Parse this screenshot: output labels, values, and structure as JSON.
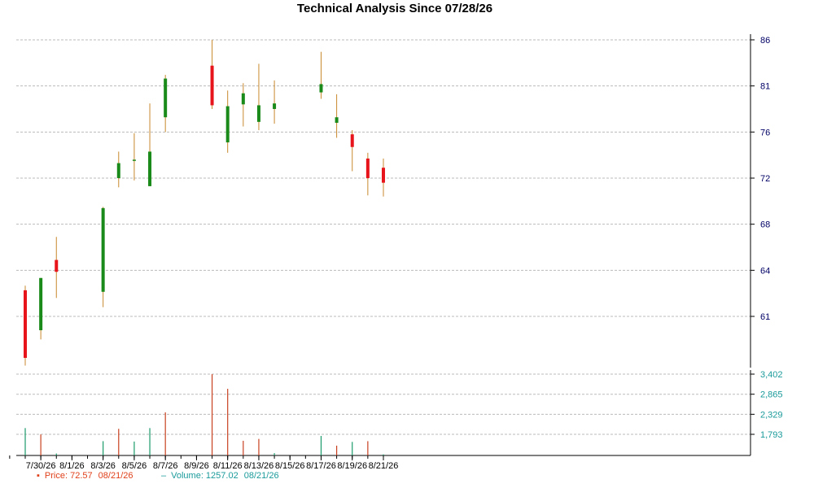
{
  "chart_data": {
    "type": "candlestick",
    "title": "Technical Analysis Since 07/28/26",
    "price_axis": {
      "ticks": [
        61,
        64,
        68,
        72,
        76,
        81,
        86
      ]
    },
    "volume_axis": {
      "ticks": [
        "1,793",
        "2,329",
        "2,865",
        "3,402"
      ],
      "tick_values": [
        1793,
        2329,
        2865,
        3402
      ]
    },
    "x_tick_labels": [
      "7/30/26",
      "8/1/26",
      "8/3/26",
      "8/5/26",
      "8/7/26",
      "8/9/26",
      "8/11/26",
      "8/13/26",
      "8/15/26",
      "8/17/26",
      "8/19/26",
      "8/21/26"
    ],
    "candles": [
      {
        "date": "7/29/26",
        "open": 62.7,
        "high": 63.0,
        "low": 57.8,
        "close": 58.3
      },
      {
        "date": "7/30/26",
        "open": 60.1,
        "high": 63.5,
        "low": 59.5,
        "close": 63.5
      },
      {
        "date": "7/31/26",
        "open": 64.9,
        "high": 66.9,
        "low": 62.2,
        "close": 63.9
      },
      {
        "date": "8/3/26",
        "open": 62.6,
        "high": 69.5,
        "low": 61.6,
        "close": 69.4
      },
      {
        "date": "8/4/26",
        "open": 72.0,
        "high": 74.3,
        "low": 71.2,
        "close": 73.3
      },
      {
        "date": "8/5/26",
        "open": 73.6,
        "high": 75.9,
        "low": 71.8,
        "close": 73.6
      },
      {
        "date": "8/6/26",
        "open": 71.3,
        "high": 79.1,
        "low": 71.3,
        "close": 74.3
      },
      {
        "date": "8/7/26",
        "open": 77.6,
        "high": 82.2,
        "low": 76.0,
        "close": 81.8
      },
      {
        "date": "8/10/26",
        "open": 83.2,
        "high": 86.0,
        "low": 78.5,
        "close": 78.9
      },
      {
        "date": "8/11/26",
        "open": 75.1,
        "high": 80.5,
        "low": 74.2,
        "close": 78.8
      },
      {
        "date": "8/12/26",
        "open": 79.0,
        "high": 81.3,
        "low": 76.6,
        "close": 80.2
      },
      {
        "date": "8/13/26",
        "open": 77.1,
        "high": 83.4,
        "low": 76.2,
        "close": 78.9
      },
      {
        "date": "8/14/26",
        "open": 78.5,
        "high": 81.6,
        "low": 76.9,
        "close": 79.1
      },
      {
        "date": "8/17/26",
        "open": 80.3,
        "high": 84.7,
        "low": 79.6,
        "close": 81.2
      },
      {
        "date": "8/18/26",
        "open": 77.0,
        "high": 80.1,
        "low": 75.5,
        "close": 77.6
      },
      {
        "date": "8/19/26",
        "open": 75.8,
        "high": 76.2,
        "low": 72.6,
        "close": 74.7
      },
      {
        "date": "8/20/26",
        "open": 73.7,
        "high": 74.2,
        "low": 70.5,
        "close": 72.0
      },
      {
        "date": "8/21/26",
        "open": 72.9,
        "high": 73.7,
        "low": 70.4,
        "close": 71.6
      }
    ],
    "volume": [
      {
        "date": "7/29/26",
        "value": 1960,
        "color": "green"
      },
      {
        "date": "7/30/26",
        "value": 1790,
        "color": "red"
      },
      {
        "date": "7/31/26",
        "value": 1280,
        "color": "green"
      },
      {
        "date": "8/3/26",
        "value": 1610,
        "color": "green"
      },
      {
        "date": "8/4/26",
        "value": 1940,
        "color": "red"
      },
      {
        "date": "8/5/26",
        "value": 1600,
        "color": "green"
      },
      {
        "date": "8/6/26",
        "value": 1960,
        "color": "green"
      },
      {
        "date": "8/7/26",
        "value": 2380,
        "color": "red"
      },
      {
        "date": "8/10/26",
        "value": 3400,
        "color": "red"
      },
      {
        "date": "8/11/26",
        "value": 3010,
        "color": "red"
      },
      {
        "date": "8/12/26",
        "value": 1620,
        "color": "red"
      },
      {
        "date": "8/13/26",
        "value": 1670,
        "color": "red"
      },
      {
        "date": "8/14/26",
        "value": 1290,
        "color": "green"
      },
      {
        "date": "8/17/26",
        "value": 1750,
        "color": "green"
      },
      {
        "date": "8/18/26",
        "value": 1490,
        "color": "red"
      },
      {
        "date": "8/19/26",
        "value": 1590,
        "color": "green"
      },
      {
        "date": "8/20/26",
        "value": 1610,
        "color": "red"
      },
      {
        "date": "8/21/26",
        "value": 1257,
        "color": "green"
      }
    ],
    "colors": {
      "up": "#1a8a1a",
      "down": "#e8141c",
      "wick": "#c8882c",
      "volume_green": "#1a9a6a",
      "volume_red": "#c84020",
      "grid": "#bbbbbb",
      "axis_text_price": "#000066",
      "axis_text_volume": "#1a9a9a"
    },
    "grid": true
  },
  "legend": {
    "price_label": "Price: 72.57",
    "price_date": "08/21/26",
    "volume_label": "Volume: 1257.02",
    "volume_date": "08/21/26"
  }
}
